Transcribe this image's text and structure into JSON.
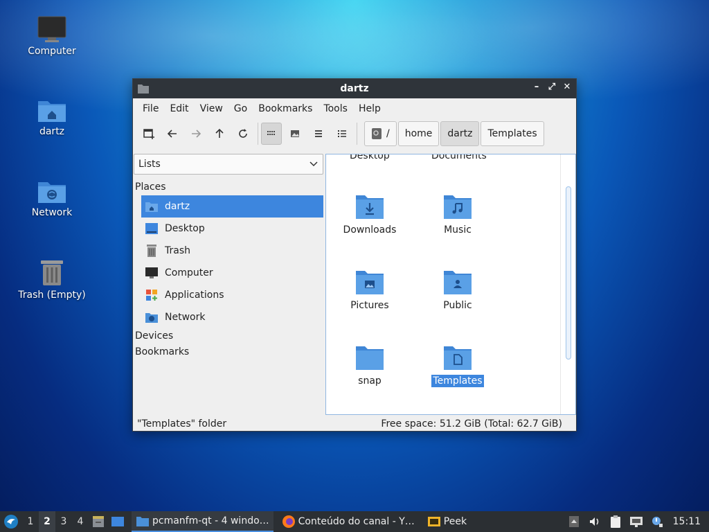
{
  "desktop": {
    "icons": [
      {
        "label": "Computer"
      },
      {
        "label": "dartz"
      },
      {
        "label": "Network"
      },
      {
        "label": "Trash (Empty)"
      }
    ]
  },
  "window": {
    "title": "dartz",
    "controls": {
      "minimize": "–",
      "maximize": "⤢",
      "close": "✕"
    },
    "menu": [
      "File",
      "Edit",
      "View",
      "Go",
      "Bookmarks",
      "Tools",
      "Help"
    ],
    "pathbar": {
      "root": "/",
      "crumbs": [
        "home",
        "dartz",
        "Templates"
      ]
    },
    "sidebar": {
      "view_mode": "Lists",
      "places_header": "Places",
      "places": [
        {
          "label": "dartz",
          "icon": "home-folder-icon"
        },
        {
          "label": "Desktop",
          "icon": "desktop-icon"
        },
        {
          "label": "Trash",
          "icon": "trash-icon"
        },
        {
          "label": "Computer",
          "icon": "computer-icon"
        },
        {
          "label": "Applications",
          "icon": "applications-icon"
        },
        {
          "label": "Network",
          "icon": "network-folder-icon"
        }
      ],
      "devices_header": "Devices",
      "bookmarks_header": "Bookmarks"
    },
    "files": {
      "partial": [
        "Desktop",
        "Documents"
      ],
      "items": [
        {
          "label": "Downloads",
          "icon": "downloads-folder-icon"
        },
        {
          "label": "Music",
          "icon": "music-folder-icon"
        },
        {
          "label": "Pictures",
          "icon": "pictures-folder-icon"
        },
        {
          "label": "Public",
          "icon": "public-folder-icon"
        },
        {
          "label": "snap",
          "icon": "folder-icon"
        },
        {
          "label": "Templates",
          "icon": "templates-folder-icon"
        }
      ]
    },
    "status": {
      "left": "\"Templates\" folder",
      "right": "Free space: 51.2 GiB (Total: 62.7 GiB)"
    }
  },
  "taskbar": {
    "desktops": [
      "1",
      "2",
      "3",
      "4"
    ],
    "current_desktop": "2",
    "tasks": [
      {
        "label": "pcmanfm-qt - 4 windo…",
        "icon": "folder-icon"
      },
      {
        "label": "Conteúdo do canal - Y…",
        "icon": "firefox-icon"
      },
      {
        "label": "Peek",
        "icon": "peek-icon"
      }
    ],
    "clock": "15:11"
  },
  "colors": {
    "accent": "#3d86de",
    "folder": "#4a90d9",
    "titlebar": "#2f343a",
    "taskbar": "#2b2f33"
  }
}
